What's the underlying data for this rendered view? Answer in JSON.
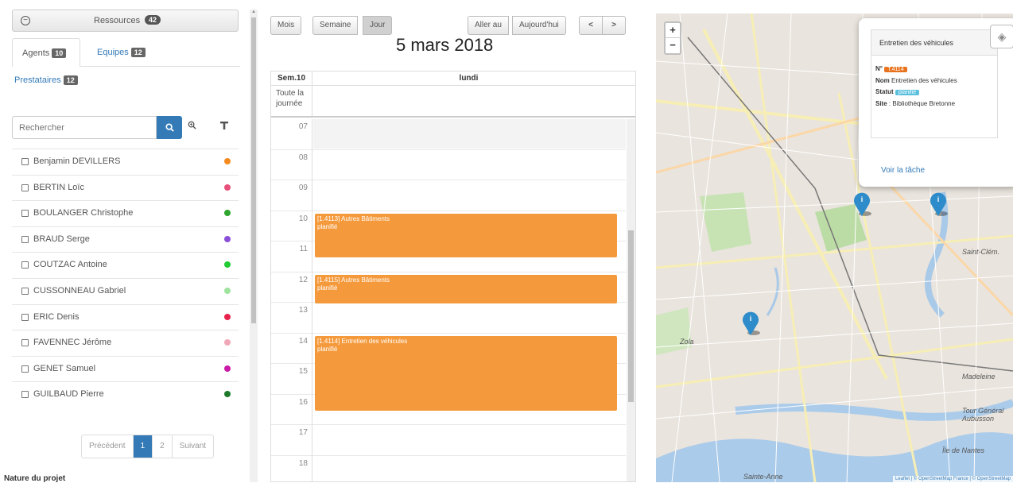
{
  "resources": {
    "title": "Ressources",
    "count": "42"
  },
  "tabs": {
    "agents": {
      "label": "Agents",
      "count": "10"
    },
    "equipes": {
      "label": "Equipes",
      "count": "12"
    },
    "prestataires": {
      "label": "Prestataires",
      "count": "12"
    }
  },
  "search": {
    "placeholder": "Rechercher"
  },
  "agents": [
    {
      "name": "Benjamin DEVILLERS",
      "color": "#f58a1f"
    },
    {
      "name": "BERTIN Loïc",
      "color": "#e8507a"
    },
    {
      "name": "BOULANGER Christophe",
      "color": "#2ea52e"
    },
    {
      "name": "BRAUD Serge",
      "color": "#8a4fd8"
    },
    {
      "name": "COUTZAC Antoine",
      "color": "#22cc33"
    },
    {
      "name": "CUSSONNEAU Gabriel",
      "color": "#9fe39f"
    },
    {
      "name": "ERIC Denis",
      "color": "#e8234b"
    },
    {
      "name": "FAVENNEC Jérôme",
      "color": "#f0a8b8"
    },
    {
      "name": "GENET Samuel",
      "color": "#cc1aa8"
    },
    {
      "name": "GUILBAUD Pierre",
      "color": "#1e7a2a"
    }
  ],
  "pagination": {
    "prev": "Précédent",
    "page1": "1",
    "page2": "2",
    "next": "Suivant"
  },
  "footer_label": "Nature du projet",
  "calendar": {
    "views": {
      "month": "Mois",
      "week": "Semaine",
      "day": "Jour"
    },
    "goto": "Aller au",
    "today": "Aujourd'hui",
    "prev": "<",
    "next": ">",
    "title": "5 mars 2018",
    "week_label": "Sem.10",
    "day_label": "lundi",
    "allday_label": "Toute la journée",
    "hours": [
      "07",
      "08",
      "09",
      "10",
      "11",
      "12",
      "13",
      "14",
      "15",
      "16",
      "17",
      "18"
    ],
    "events": [
      {
        "title": "[1.4113] Autres Bâtiments",
        "status": "planifié"
      },
      {
        "title": "[1.4115] Autres Bâtiments",
        "status": "planifié"
      },
      {
        "title": "[1.4114] Entretien des véhicules",
        "status": "planifié"
      }
    ]
  },
  "map": {
    "zoom_in": "+",
    "zoom_out": "−",
    "popup": {
      "title": "Entretien des véhicules",
      "no_label": "N°",
      "no_value": "T.4114",
      "nom_label": "Nom",
      "nom_value": "Entretien des véhicules",
      "statut_label": "Statut",
      "statut_value": "planifié",
      "site_label": "Site",
      "site_value": "Bibliothèque Bretonne",
      "link": "Voir la tâche"
    },
    "attribution": "Leaflet | © OpenStreetMap France | © OpenStreetMap",
    "place_labels": [
      "Zola",
      "Madeleine",
      "Île de Nantes",
      "Sainte-Anne",
      "Saint-Clém.",
      "Tour Général Aubusson"
    ]
  }
}
